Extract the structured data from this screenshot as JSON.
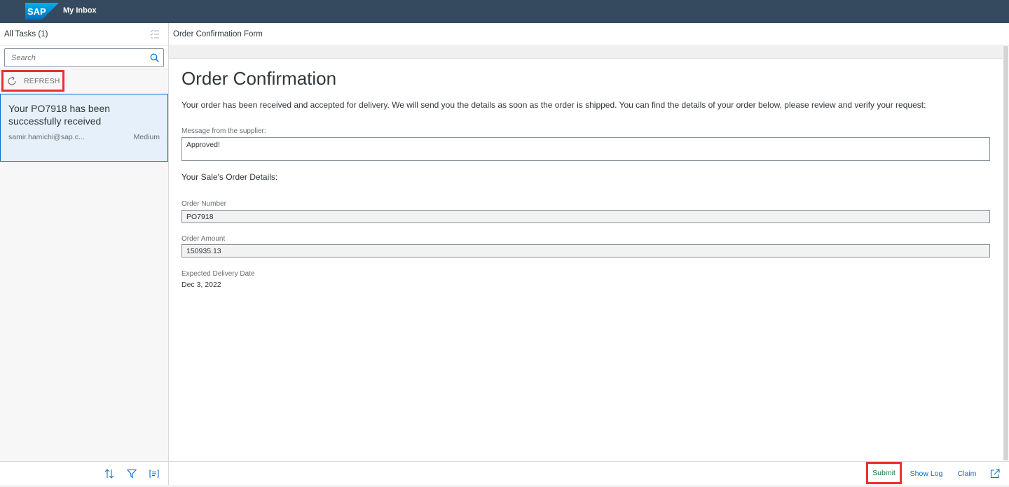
{
  "shell": {
    "logo_text": "SAP",
    "app_title": "My Inbox"
  },
  "master": {
    "title": "All Tasks (1)",
    "search_placeholder": "Search",
    "refresh_label": "REFRESH",
    "tasks": [
      {
        "title": "Your PO7918 has been successfully received",
        "email": "samir.hamichi@sap.c...",
        "priority": "Medium"
      }
    ]
  },
  "detail": {
    "header_title": "Order Confirmation Form",
    "form_title": "Order Confirmation",
    "description": "Your order has been received and accepted for delivery. We will send you the details as soon as the order is shipped. You can find the details of your order below, please review and verify your request:",
    "supplier_message_label": "Message from the supplier:",
    "supplier_message_value": "Approved!",
    "section_title": "Your Sale's Order Details:",
    "order_number_label": "Order Number",
    "order_number_value": "PO7918",
    "order_amount_label": "Order Amount",
    "order_amount_value": "150935.13",
    "delivery_date_label": "Expected Delivery Date",
    "delivery_date_value": "Dec 3, 2022"
  },
  "footer": {
    "submit_label": "Submit",
    "show_log_label": "Show Log",
    "claim_label": "Claim"
  },
  "colors": {
    "shell_bg": "#354a5f",
    "accent": "#0a6ed1",
    "highlight": "#e8312f",
    "submit_text": "#107e3e"
  },
  "icons": [
    "sap-logo",
    "list-settings-icon",
    "search-icon",
    "refresh-icon",
    "sort-icon",
    "filter-icon",
    "group-icon",
    "open-in-new-icon"
  ]
}
